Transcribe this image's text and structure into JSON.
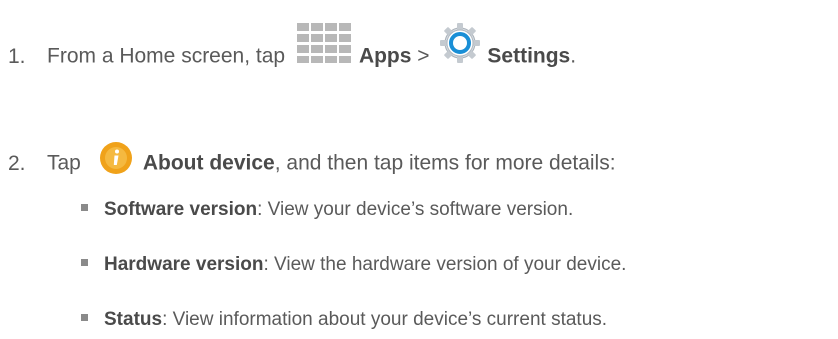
{
  "step1": {
    "number": "1.",
    "text_before": "From a Home screen, tap",
    "apps_label": "Apps",
    "separator": ">",
    "settings_label": "Settings",
    "end": "."
  },
  "step2": {
    "number": "2.",
    "tap": "Tap",
    "about_label": "About device",
    "text_after": ", and then tap items for more details:"
  },
  "bullets": [
    {
      "term": "Software version",
      "desc": ": View your device’s software version."
    },
    {
      "term": "Hardware version",
      "desc": ": View the hardware version of your device."
    },
    {
      "term": "Status",
      "desc": ": View information about your device’s current status."
    }
  ],
  "icons": {
    "apps": "apps-grid-icon",
    "settings": "settings-gear-icon",
    "about": "info-icon"
  },
  "colors": {
    "text": "#5a5a5a",
    "settings_blue": "#1a8fd6",
    "about_orange": "#f0a21a",
    "apps_grid": "#b8b8b8"
  }
}
